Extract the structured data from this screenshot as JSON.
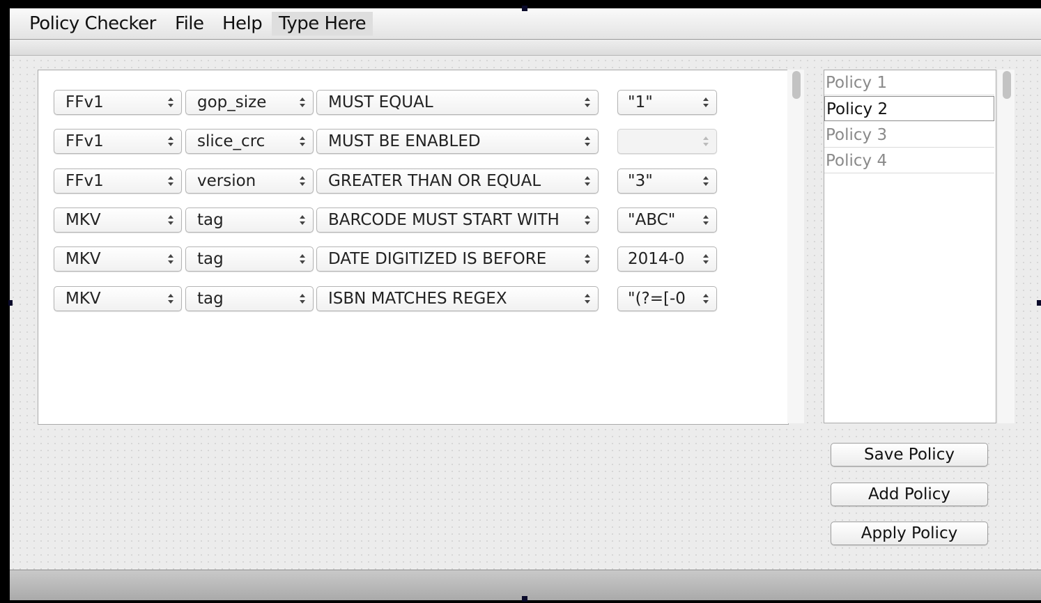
{
  "menubar": {
    "items": [
      "Policy Checker",
      "File",
      "Help"
    ],
    "editable_label": "Type Here"
  },
  "rules": [
    {
      "container": "FFv1",
      "field": "gop_size",
      "operator": "MUST EQUAL",
      "value": "\"1\""
    },
    {
      "container": "FFv1",
      "field": "slice_crc",
      "operator": "MUST BE ENABLED",
      "value": ""
    },
    {
      "container": "FFv1",
      "field": "version",
      "operator": "GREATER THAN OR EQUAL",
      "value": "\"3\""
    },
    {
      "container": "MKV",
      "field": "tag",
      "operator": "BARCODE MUST START WITH",
      "value": "\"ABC\""
    },
    {
      "container": "MKV",
      "field": "tag",
      "operator": "DATE DIGITIZED IS BEFORE",
      "value": "2014-0"
    },
    {
      "container": "MKV",
      "field": "tag",
      "operator": "ISBN MATCHES REGEX",
      "value": "\"(?=[-0"
    }
  ],
  "policies": {
    "items": [
      "Policy 1",
      "Policy 2",
      "Policy 3",
      "Policy 4"
    ],
    "selected": "Policy 2"
  },
  "buttons": {
    "save": "Save Policy",
    "add": "Add Policy",
    "apply": "Apply Policy"
  }
}
